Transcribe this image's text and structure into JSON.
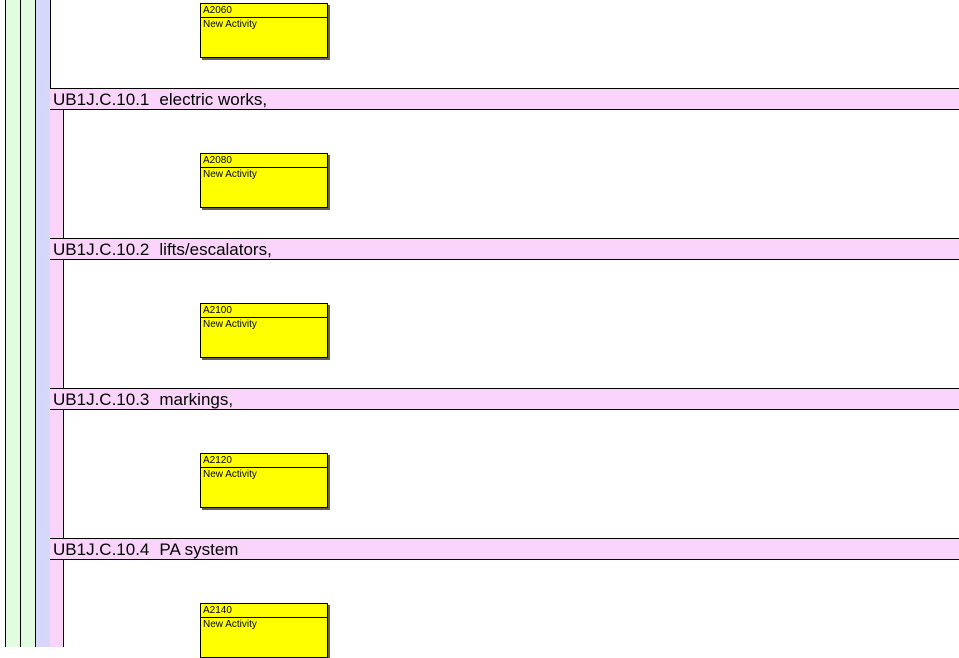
{
  "sections": [
    {
      "code": "UB1J.C.10.1",
      "title": "electric works,"
    },
    {
      "code": "UB1J.C.10.2",
      "title": "lifts/escalators,"
    },
    {
      "code": "UB1J.C.10.3",
      "title": "markings,"
    },
    {
      "code": "UB1J.C.10.4",
      "title": "PA system"
    }
  ],
  "activities": [
    {
      "code": "A2060",
      "name": "New Activity"
    },
    {
      "code": "A2080",
      "name": "New Activity"
    },
    {
      "code": "A2100",
      "name": "New Activity"
    },
    {
      "code": "A2120",
      "name": "New Activity"
    },
    {
      "code": "A2140",
      "name": "New Activity"
    }
  ],
  "colors": {
    "activity_fill": "#ffff00",
    "section_header": "#fbd4fb",
    "outer_band_green": "#e2fce2",
    "outer_band_blue": "#d6d8fb"
  }
}
